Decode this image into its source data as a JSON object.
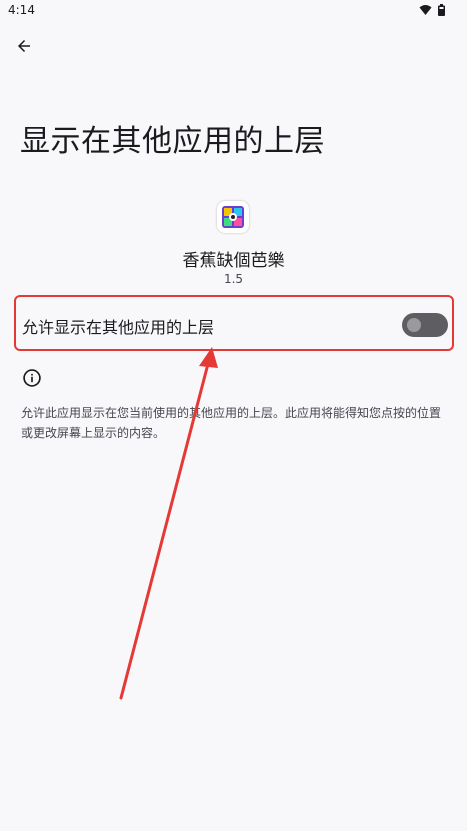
{
  "status_bar": {
    "time": "4:14"
  },
  "page": {
    "title": "显示在其他应用的上层"
  },
  "app": {
    "name": "香蕉缺個芭樂",
    "version": "1.5"
  },
  "toggle": {
    "label": "允许显示在其他应用的上层",
    "enabled": false
  },
  "description": "允许此应用显示在您当前使用的其他应用的上层。此应用将能得知您点按的位置或更改屏幕上显示的内容。",
  "colors": {
    "annotation": "#E53935",
    "switch_track": "#5E5E62",
    "switch_thumb": "#9A999E"
  }
}
